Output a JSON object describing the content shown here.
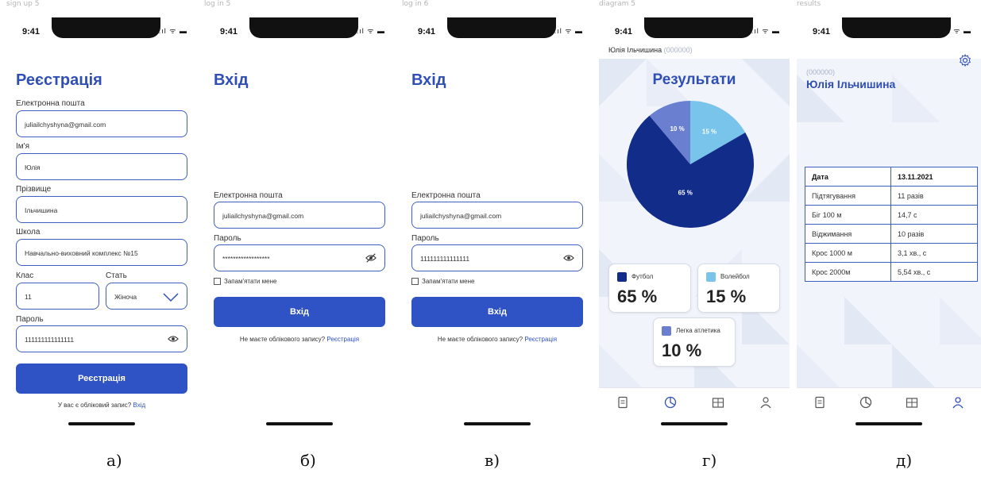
{
  "frames": {
    "a": "sign up 5",
    "b": "log in 5",
    "c": "log in 6",
    "d": "diagram 5",
    "e": "results"
  },
  "status": {
    "time": "9:41",
    "signal": "..ıl ᯤ ▬"
  },
  "captions": [
    "а)",
    "б)",
    "в)",
    "г)",
    "д)"
  ],
  "signup": {
    "title": "Реєстрація",
    "email_label": "Електронна пошта",
    "email_value": "juliailchyshyna@gmail.com",
    "name_label": "Ім'я",
    "name_value": "Юлія",
    "surname_label": "Прізвище",
    "surname_value": "Ільчишина",
    "school_label": "Школа",
    "school_value": "Навчально-виховний комплекс №15",
    "class_label": "Клас",
    "class_value": "11",
    "gender_label": "Стать",
    "gender_value": "Жіноча",
    "password_label": "Пароль",
    "password_value": "111111111111111",
    "submit_label": "Реєстрація",
    "footer_text": "У вас є обліковий запис?",
    "footer_link": "Вхід"
  },
  "login_hidden": {
    "title": "Вхід",
    "email_label": "Електронна пошта",
    "email_value": "juliailchyshyna@gmail.com",
    "password_label": "Пароль",
    "password_value": "******************",
    "remember_label": "Запам'ятати мене",
    "submit_label": "Вхід",
    "footer_text": "Не маєте облікового запису?",
    "footer_link": "Реєстрація"
  },
  "login_shown": {
    "title": "Вхід",
    "email_label": "Електронна пошта",
    "email_value": "juliailchyshyna@gmail.com",
    "password_label": "Пароль",
    "password_value": "111111111111111",
    "remember_label": "Запам'ятати мене",
    "submit_label": "Вхід",
    "footer_text": "Не маєте облікового запису?",
    "footer_link": "Реєстрація"
  },
  "diagram": {
    "user_name": "Юлія Ільчишина",
    "user_id": "(000000)",
    "title": "Результати",
    "legend": [
      {
        "name": "Футбол",
        "value": "65 %",
        "color": "#122c8a"
      },
      {
        "name": "Волейбол",
        "value": "15 %",
        "color": "#79c4ea"
      },
      {
        "name": "Легка атлетика",
        "value": "10 %",
        "color": "#6b7fd1"
      }
    ]
  },
  "chart_data": {
    "type": "pie",
    "title": "Результати",
    "categories": [
      "Футбол",
      "Волейбол",
      "Легка атлетика"
    ],
    "values": [
      65,
      15,
      10
    ],
    "labels": [
      "65 %",
      "15 %",
      "10 %"
    ],
    "colors": [
      "#122c8a",
      "#79c4ea",
      "#6b7fd1"
    ]
  },
  "results": {
    "user_id": "(000000)",
    "user_name": "Юлія Ільчишина",
    "header": [
      "Дата",
      "13.11.2021"
    ],
    "rows": [
      [
        "Підтягування",
        "11 разів"
      ],
      [
        "Біг 100 м",
        "14,7 с"
      ],
      [
        "Віджимання",
        "10 разів"
      ],
      [
        "Крос 1000 м",
        "3,1 хв., с"
      ],
      [
        "Крос 2000м",
        "5,54 хв., с"
      ]
    ]
  }
}
